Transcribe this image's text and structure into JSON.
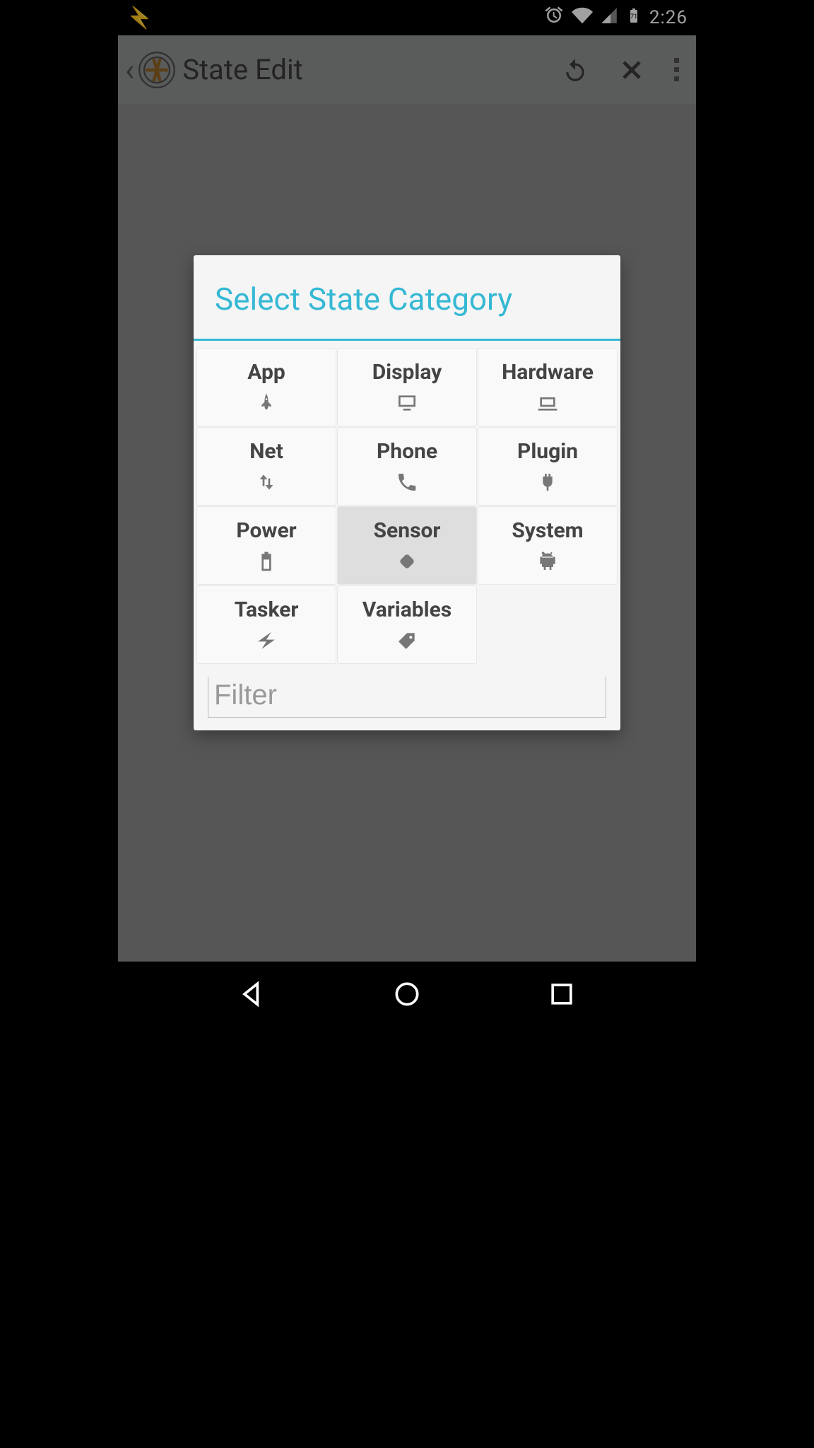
{
  "statusbar": {
    "time": "2:26"
  },
  "appbar": {
    "title": "State Edit"
  },
  "dialog": {
    "title": "Select State Category",
    "categories": [
      {
        "label": "App"
      },
      {
        "label": "Display"
      },
      {
        "label": "Hardware"
      },
      {
        "label": "Net"
      },
      {
        "label": "Phone"
      },
      {
        "label": "Plugin"
      },
      {
        "label": "Power"
      },
      {
        "label": "Sensor"
      },
      {
        "label": "System"
      },
      {
        "label": "Tasker"
      },
      {
        "label": "Variables"
      }
    ],
    "filter_placeholder": "Filter"
  }
}
